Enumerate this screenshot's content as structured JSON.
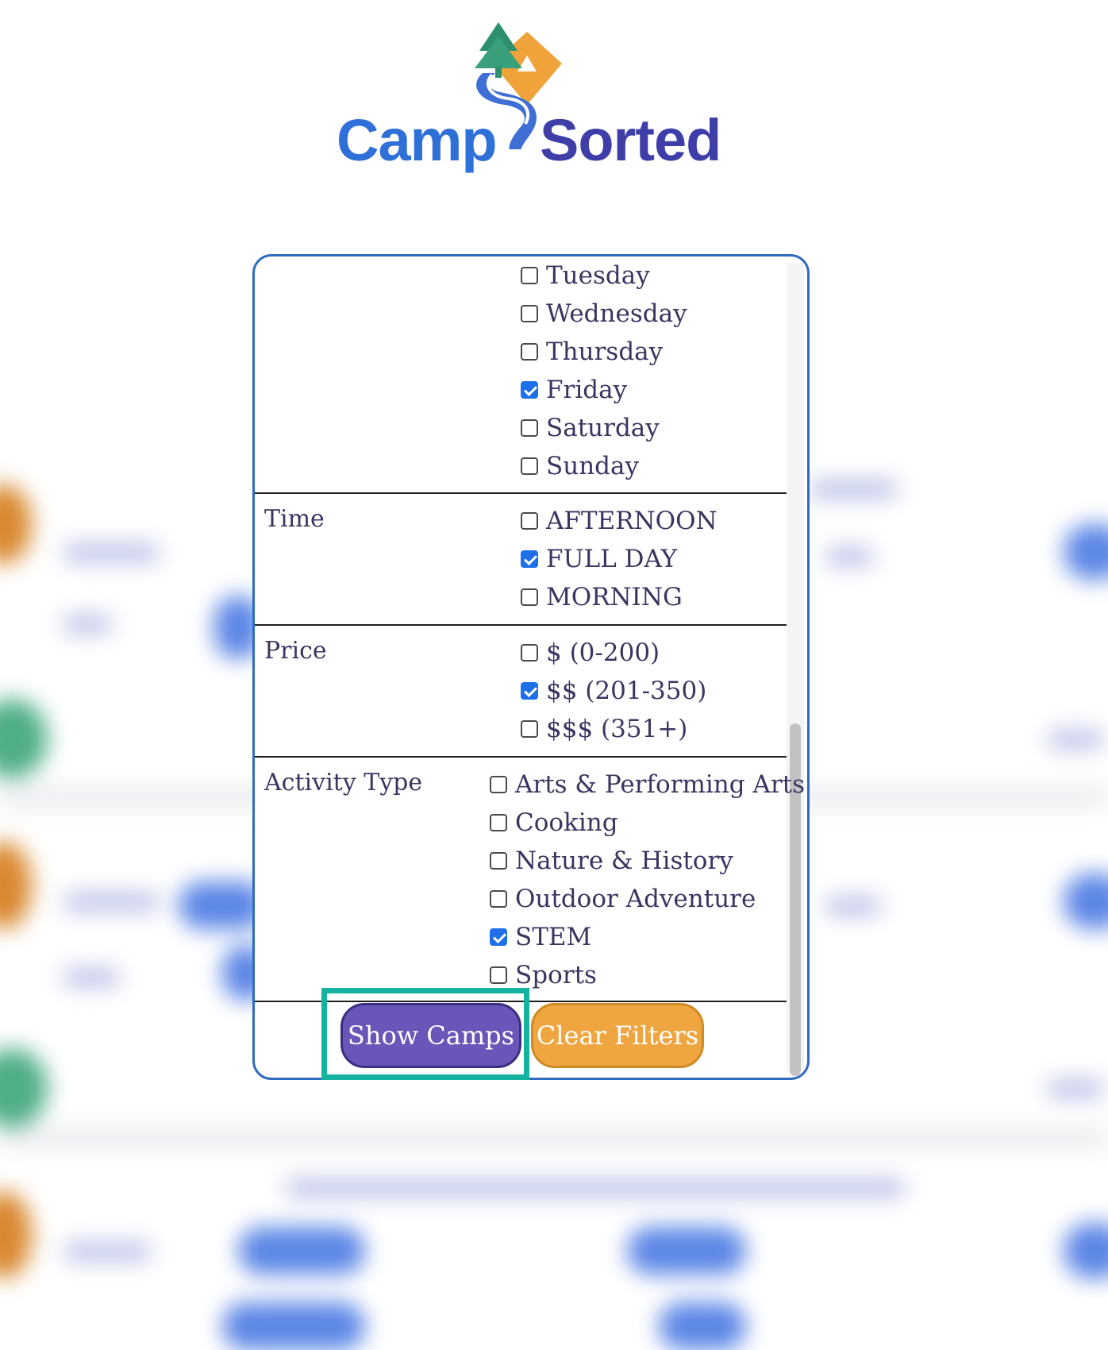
{
  "brand": {
    "name_left": "Camp",
    "name_right": "Sorted",
    "colors": {
      "blue": "#2f6fd8",
      "indigo": "#3f3ea8",
      "teal": "#2e8f6f",
      "orange": "#f0a33a"
    }
  },
  "filters": {
    "day": {
      "options": [
        {
          "label": "Tuesday",
          "checked": false
        },
        {
          "label": "Wednesday",
          "checked": false
        },
        {
          "label": "Thursday",
          "checked": false
        },
        {
          "label": "Friday",
          "checked": true
        },
        {
          "label": "Saturday",
          "checked": false
        },
        {
          "label": "Sunday",
          "checked": false
        }
      ]
    },
    "time": {
      "label": "Time",
      "options": [
        {
          "label": "AFTERNOON",
          "checked": false
        },
        {
          "label": "FULL DAY",
          "checked": true
        },
        {
          "label": "MORNING",
          "checked": false
        }
      ]
    },
    "price": {
      "label": "Price",
      "options": [
        {
          "label": "$ (0-200)",
          "checked": false
        },
        {
          "label": "$$ (201-350)",
          "checked": true
        },
        {
          "label": "$$$ (351+)",
          "checked": false
        }
      ]
    },
    "activity": {
      "label": "Activity Type",
      "options": [
        {
          "label": "Arts & Performing Arts",
          "checked": false
        },
        {
          "label": "Cooking",
          "checked": false
        },
        {
          "label": "Nature & History",
          "checked": false
        },
        {
          "label": "Outdoor Adventure",
          "checked": false
        },
        {
          "label": "STEM",
          "checked": true
        },
        {
          "label": "Sports",
          "checked": false
        }
      ]
    }
  },
  "actions": {
    "show_label": "Show Camps",
    "clear_label": "Clear Filters",
    "show_color": "#6c55b8",
    "clear_color": "#efa640",
    "highlight_color": "#13b3a0"
  }
}
